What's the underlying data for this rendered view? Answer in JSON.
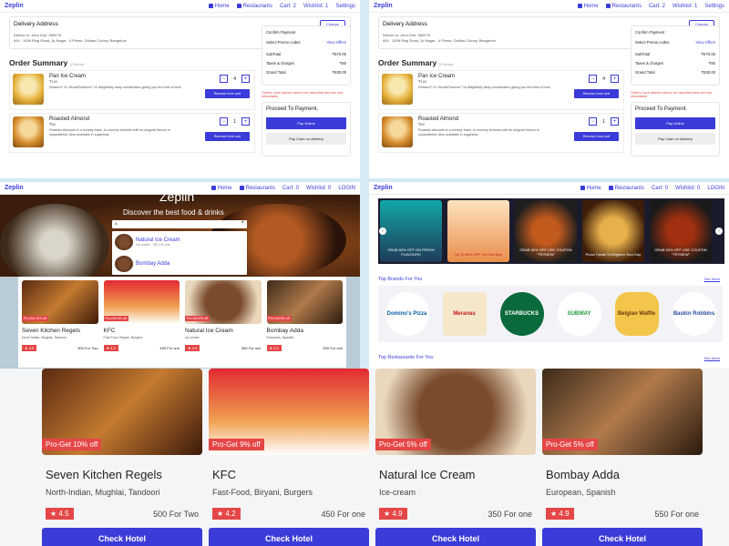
{
  "nav": {
    "logo": "Zeplin",
    "home": "Home",
    "restaurants": "Restaurants",
    "cart": "Cart: 2",
    "wishlist": "Wishlist: 1",
    "settings": "Settings",
    "cart0": "Cart: 0",
    "wishlist0": "Wishlist: 0",
    "login": "LOGIN"
  },
  "checkout": {
    "delivery_title": "Delivery Address",
    "change": "Change",
    "deliver_to": "Deliver to: John Doe, 560078",
    "address": "#54 , 100ft Ring Road, Jp Nagar - 4 Phase, Dollars Colony, Bangalore",
    "order_summary": "Order Summary",
    "items_count": "(2 items)",
    "items": [
      {
        "name": "Pan Ice Cream",
        "price": "₹100",
        "desc": "Dessert? Or 'MouthFreshner'? A delightfully tasty combination giving you the best of both.",
        "qty": "4",
        "remove": "Remove from cart"
      },
      {
        "name": "Roasted Almond",
        "price": "₹80",
        "desc": "Roasted almonds in a creamy base, to crunchy textures with its singular flavour is unparalleled. Also available in sugarless.",
        "qty": "1",
        "remove": "Remove from cart"
      }
    ],
    "confirm": "Confirm Payment",
    "promo": "Select Promo codes",
    "view_offers": "View Offers",
    "subtotal_l": "SubTotal",
    "subtotal": "₹570.00",
    "tax_l": "Taxes & charges",
    "tax": "₹60",
    "grand_l": "Grand Total",
    "grand": "₹630.00",
    "note": "Orders once placed cannot be cancelled and are non-refundable",
    "proceed": "Proceed To Payment.",
    "pay_online": "Pay Online",
    "pay_cash": "Pay Cash on delivery"
  },
  "hero": {
    "title": "Zeplin",
    "sub": "Discover the best food & drinks",
    "query": "A",
    "results": [
      {
        "name": "Natural Ice Cream",
        "desc": "Ice-cream · 350 For one"
      },
      {
        "name": "Bombay Adda",
        "desc": ""
      }
    ]
  },
  "restaurants": [
    {
      "name": "Seven Kitchen Regels",
      "cuisine": "North-Indian, Mughlai, Tandoori",
      "rating": "4.5",
      "price": "500 For Two",
      "offer": "Pro-Get 10% off"
    },
    {
      "name": "KFC",
      "cuisine": "Fast-Food, Biryani, Burgers",
      "rating": "4.2",
      "price": "450 For one",
      "offer": "Pro-Get 9% off"
    },
    {
      "name": "Natural Ice Cream",
      "cuisine": "Ice-cream",
      "rating": "4.9",
      "price": "350 For one",
      "offer": "Pro-Get 5% off"
    },
    {
      "name": "Bombay Adda",
      "cuisine": "European, Spanish",
      "rating": "4.9",
      "price": "550 For one",
      "offer": "Pro-Get 5% off"
    }
  ],
  "check": "Check Hotel",
  "banners": [
    "GRAB 60% OFF ON FRESH FLAVOURS",
    "Up To 60% OFF On Holi-Day",
    "GRAB 50% OFF USE COUPON \"TRYNEW\"",
    "Pizza Treats To Brighten Your Day",
    "GRAB 50% OFF USE COUPON \"TRYNEW\""
  ],
  "brands_title": "Top Brands For You",
  "see_more": "See More",
  "top_rest": "Top Restaurants For You",
  "brands": [
    "Domino's Pizza",
    "Meranas",
    "STARBUCKS",
    "SUBWAY",
    "Belgian Waffle",
    "Baskin Robbins"
  ]
}
